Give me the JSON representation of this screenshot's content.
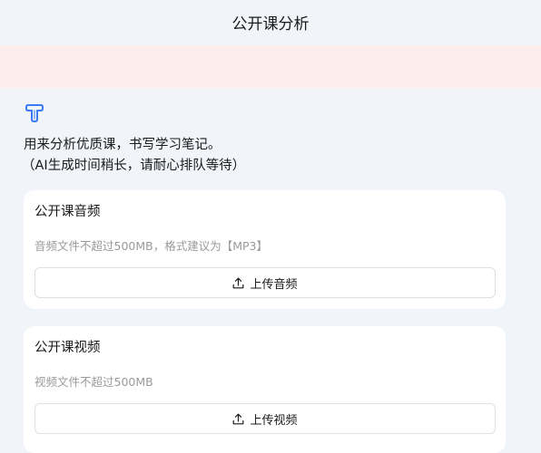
{
  "header": {
    "title": "公开课分析"
  },
  "intro": {
    "line1": "用来分析优质课，书写学习笔记。",
    "line2": "（AI生成时间稍长，请耐心排队等待）"
  },
  "audio_card": {
    "title": "公开课音频",
    "hint": "音频文件不超过500MB，格式建议为【MP3】",
    "upload_label": "上传音频"
  },
  "video_card": {
    "title": "公开课视频",
    "hint": "视频文件不超过500MB",
    "upload_label": "上传视频"
  },
  "icons": {
    "logo": "brand-logo-icon",
    "upload": "upload-icon"
  },
  "colors": {
    "page_bg": "#f1f4f9",
    "banner_bg": "#feeded",
    "card_bg": "#ffffff",
    "hint_text": "#9a9a9a",
    "logo_blue": "#3b7bf6"
  }
}
